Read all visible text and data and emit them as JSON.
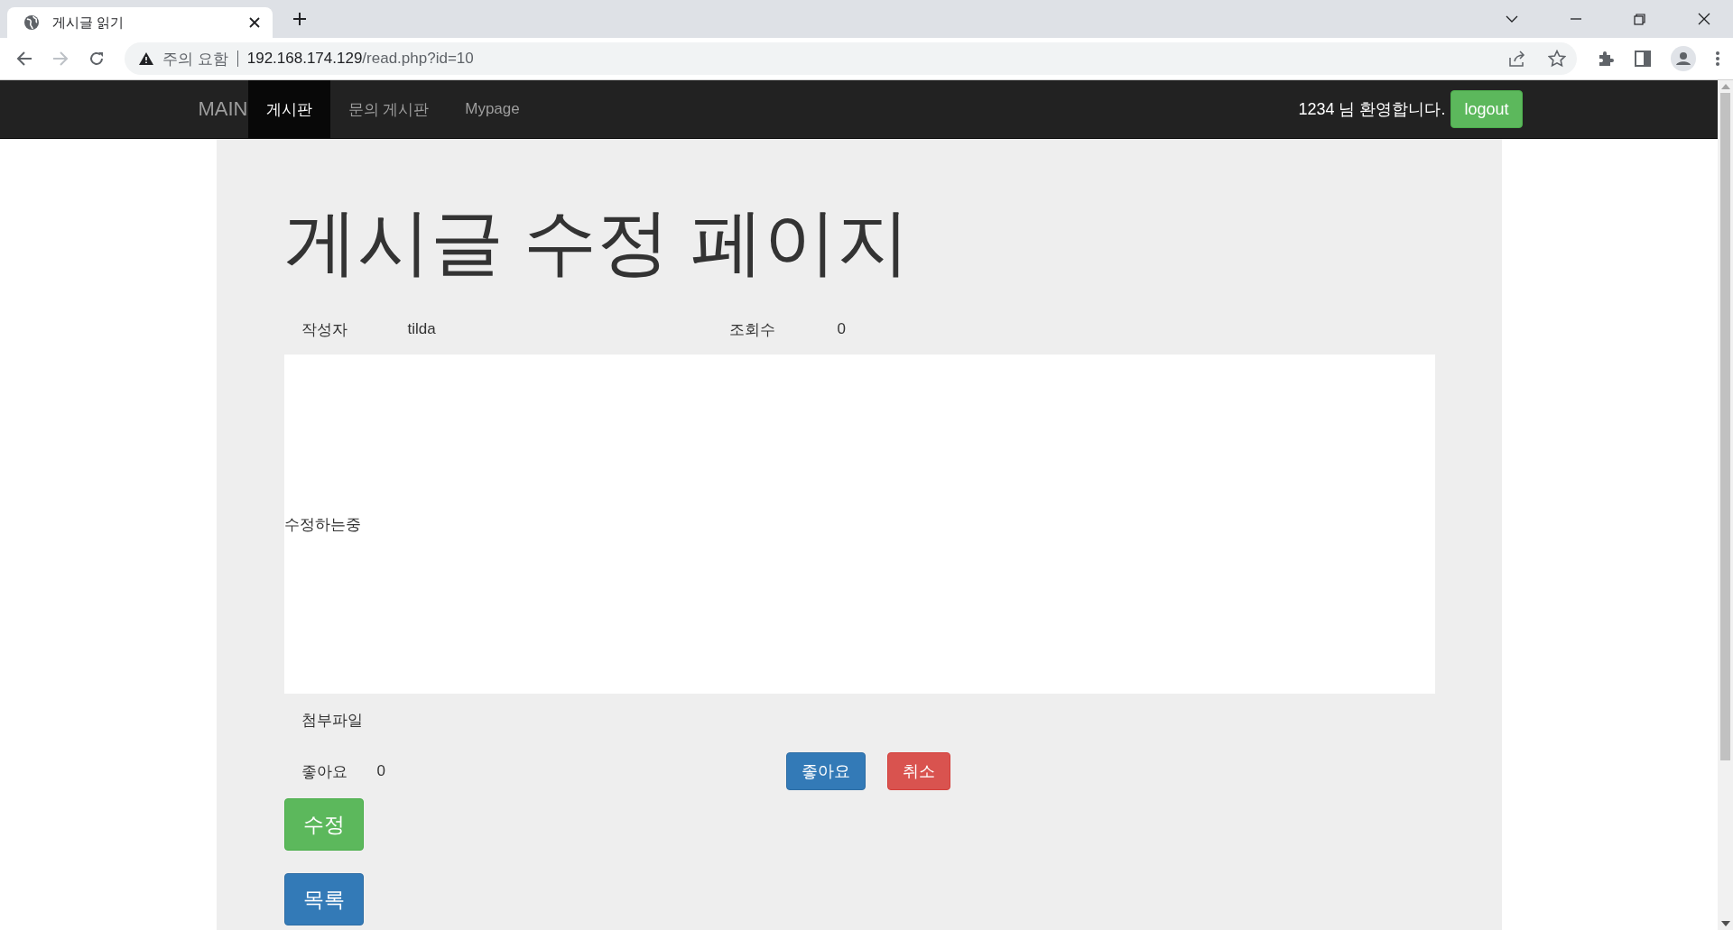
{
  "browser": {
    "tab_title": "게시글 읽기",
    "security_label": "주의 요함",
    "host": "192.168.174.129",
    "path": "/read.php?id=10",
    "forward_disabled": true
  },
  "navbar": {
    "brand": "MAIN",
    "items": [
      {
        "label": "게시판",
        "selected": true
      },
      {
        "label": "문의 게시판",
        "selected": false
      },
      {
        "label": "Mypage",
        "selected": false
      }
    ],
    "welcome": "1234 님 환영합니다.",
    "logout": "logout"
  },
  "post": {
    "heading": "게시글 수정 페이지",
    "author_label": "작성자",
    "author": "tilda",
    "views_label": "조회수",
    "views": "0",
    "content": "수정하는중",
    "attachment_label": "첨부파일",
    "likes_label": "좋아요",
    "likes": "0",
    "like_button": "좋아요",
    "cancel_button": "취소",
    "edit_button": "수정",
    "list_button": "목록"
  }
}
